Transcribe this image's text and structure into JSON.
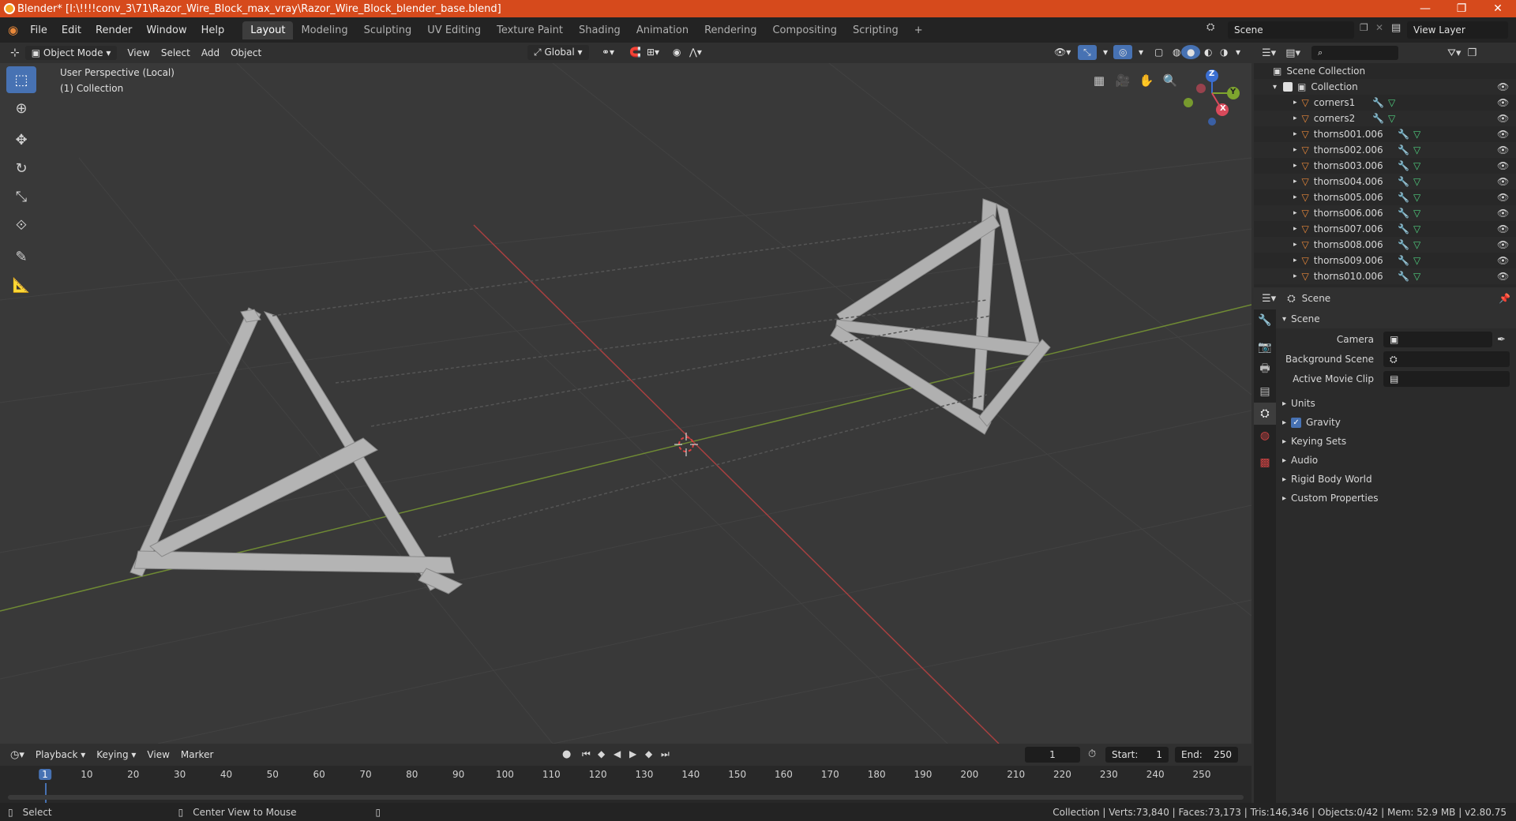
{
  "window": {
    "title": "Blender* [I:\\!!!!conv_3\\71\\Razor_Wire_Block_max_vray\\Razor_Wire_Block_blender_base.blend]",
    "minimize": "—",
    "maximize": "❐",
    "close": "✕"
  },
  "menubar": {
    "menus": [
      "File",
      "Edit",
      "Render",
      "Window",
      "Help"
    ],
    "workspaces": [
      "Layout",
      "Modeling",
      "Sculpting",
      "UV Editing",
      "Texture Paint",
      "Shading",
      "Animation",
      "Rendering",
      "Compositing",
      "Scripting"
    ],
    "add_tab": "+",
    "scene_name": "Scene",
    "view_layer": "View Layer"
  },
  "viewport_header": {
    "mode": "Object Mode",
    "menus": [
      "View",
      "Select",
      "Add",
      "Object"
    ],
    "orientation": "Global"
  },
  "viewport": {
    "perspective": "User Perspective (Local)",
    "collection": "(1) Collection",
    "gizmo_axes": {
      "z": "Z",
      "y": "Y",
      "x": "X"
    },
    "colors": {
      "grid_x": "#b83a3a",
      "grid_y": "#7fa33a",
      "bg": "#393939"
    }
  },
  "outliner": {
    "search_placeholder": "",
    "scene_collection": "Scene Collection",
    "collection": "Collection",
    "items": [
      "corners1",
      "corners2",
      "thorns001.006",
      "thorns002.006",
      "thorns003.006",
      "thorns004.006",
      "thorns005.006",
      "thorns006.006",
      "thorns007.006",
      "thorns008.006",
      "thorns009.006",
      "thorns010.006"
    ]
  },
  "properties": {
    "context": "Scene",
    "panel_title": "Scene",
    "camera_label": "Camera",
    "background_scene_label": "Background Scene",
    "active_movie_clip_label": "Active Movie Clip",
    "sections": [
      "Units",
      "Gravity",
      "Keying Sets",
      "Audio",
      "Rigid Body World",
      "Custom Properties"
    ],
    "gravity_checked": true
  },
  "timeline": {
    "menus": [
      "Playback",
      "Keying",
      "View",
      "Marker"
    ],
    "current_frame": "1",
    "start_label": "Start:",
    "start": "1",
    "end_label": "End:",
    "end": "250",
    "ruler_marks": [
      "1",
      "10",
      "20",
      "30",
      "40",
      "50",
      "60",
      "70",
      "80",
      "90",
      "100",
      "110",
      "120",
      "130",
      "140",
      "150",
      "160",
      "170",
      "180",
      "190",
      "200",
      "210",
      "220",
      "230",
      "240",
      "250"
    ]
  },
  "statusbar": {
    "select": "Select",
    "center_view": "Center View to Mouse",
    "stats": "Collection | Verts:73,840 | Faces:73,173 | Tris:146,346 | Objects:0/42 | Mem: 52.9 MB | v2.80.75"
  }
}
